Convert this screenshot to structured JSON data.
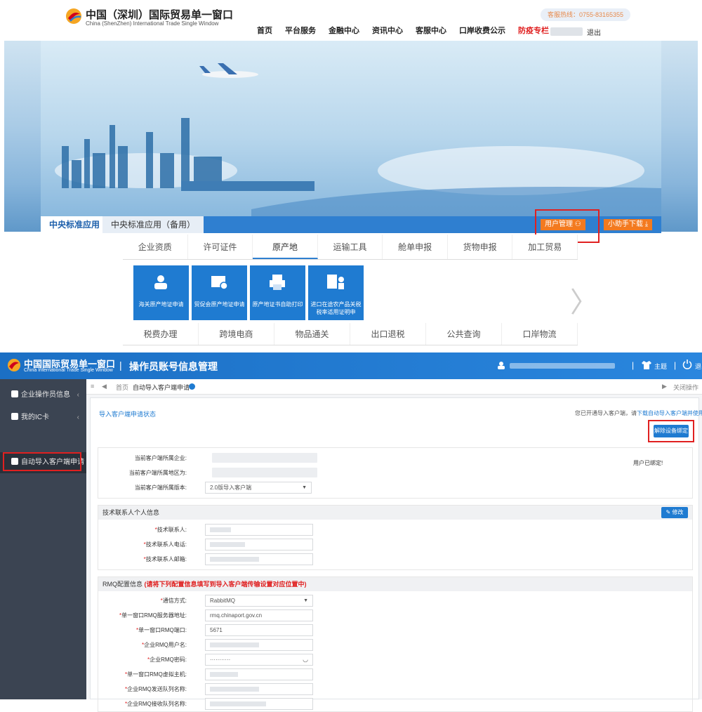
{
  "portal": {
    "logo_cn": "中国（深圳）国际贸易单一窗口",
    "logo_en": "China (ShenZhen) International Trade Single Window",
    "hotline": "客服热线：0755-83165355",
    "nav": [
      "首页",
      "平台服务",
      "金融中心",
      "资讯中心",
      "客服中心",
      "口岸收费公示",
      "防疫专栏"
    ],
    "logout": "退出",
    "tabs": [
      "中央标准应用",
      "中央标准应用（备用）"
    ],
    "user_mgmt": "用户管理",
    "helper_download": "小助手下载",
    "categories_row1": [
      "企业资质",
      "许可证件",
      "原产地",
      "运输工具",
      "舱单申报",
      "货物申报",
      "加工贸易"
    ],
    "categories_row2": [
      "税费办理",
      "跨境电商",
      "物品通关",
      "出口退税",
      "公共查询",
      "口岸物流"
    ],
    "tiles": [
      "海关原产地证申请",
      "贸促会原产地证申请",
      "原产地证书自助打印",
      "进口在途农产品关税税率适用证明申"
    ],
    "arrow_left": "〈",
    "arrow_right": "〉"
  },
  "admin": {
    "logo_cn": "中国国际贸易单一窗口",
    "logo_en": "China International Trade Single Window",
    "title": "操作员账号信息管理",
    "theme": "主题",
    "exit": "退出",
    "sidebar": [
      "企业操作员信息",
      "我的IC卡",
      "自动导入客户端申请"
    ],
    "crumbs": {
      "menu": "≡",
      "back": "◀",
      "home": "首页",
      "tab": "自动导入客户端申请",
      "fwd": "▶",
      "close_ops": "关闭操作"
    },
    "panel_title": "导入客户端申请状态",
    "note_prefix": "您已开通导入客户端，请",
    "note_link": "下载自动导入客户端并使用",
    "unbind_btn": "解除设备绑定",
    "bound_status": "用户已绑定!",
    "sec1_rows": [
      {
        "label": "当前客户端所属企业:"
      },
      {
        "label": "当前客户端所属地区为:"
      },
      {
        "label": "当前客户端所属版本:",
        "value": "2.0版导入客户端"
      }
    ],
    "sec2_title": "技术联系人个人信息",
    "edit_btn": "修改",
    "sec2_rows": [
      "技术联系人:",
      "技术联系人电话:",
      "技术联系人邮箱:"
    ],
    "sec3_title": "RMQ配置信息",
    "sec3_warn": "(请将下列配置信息填写到导入客户端传输设置对应位置中)",
    "sec3_rows": [
      {
        "label": "通信方式:",
        "value": "RabbitMQ",
        "select": true
      },
      {
        "label": "单一窗口RMQ服务器地址:",
        "value": "rmq.chinaport.gov.cn"
      },
      {
        "label": "单一窗口RMQ端口:",
        "value": "5671"
      },
      {
        "label": "企业RMQ用户名:"
      },
      {
        "label": "企业RMQ密码:",
        "value": "···········",
        "eye": true
      },
      {
        "label": "单一窗口RMQ虚拟主机:"
      },
      {
        "label": "企业RMQ发送队列名称:"
      },
      {
        "label": "企业RMQ接收队列名称:"
      }
    ]
  }
}
